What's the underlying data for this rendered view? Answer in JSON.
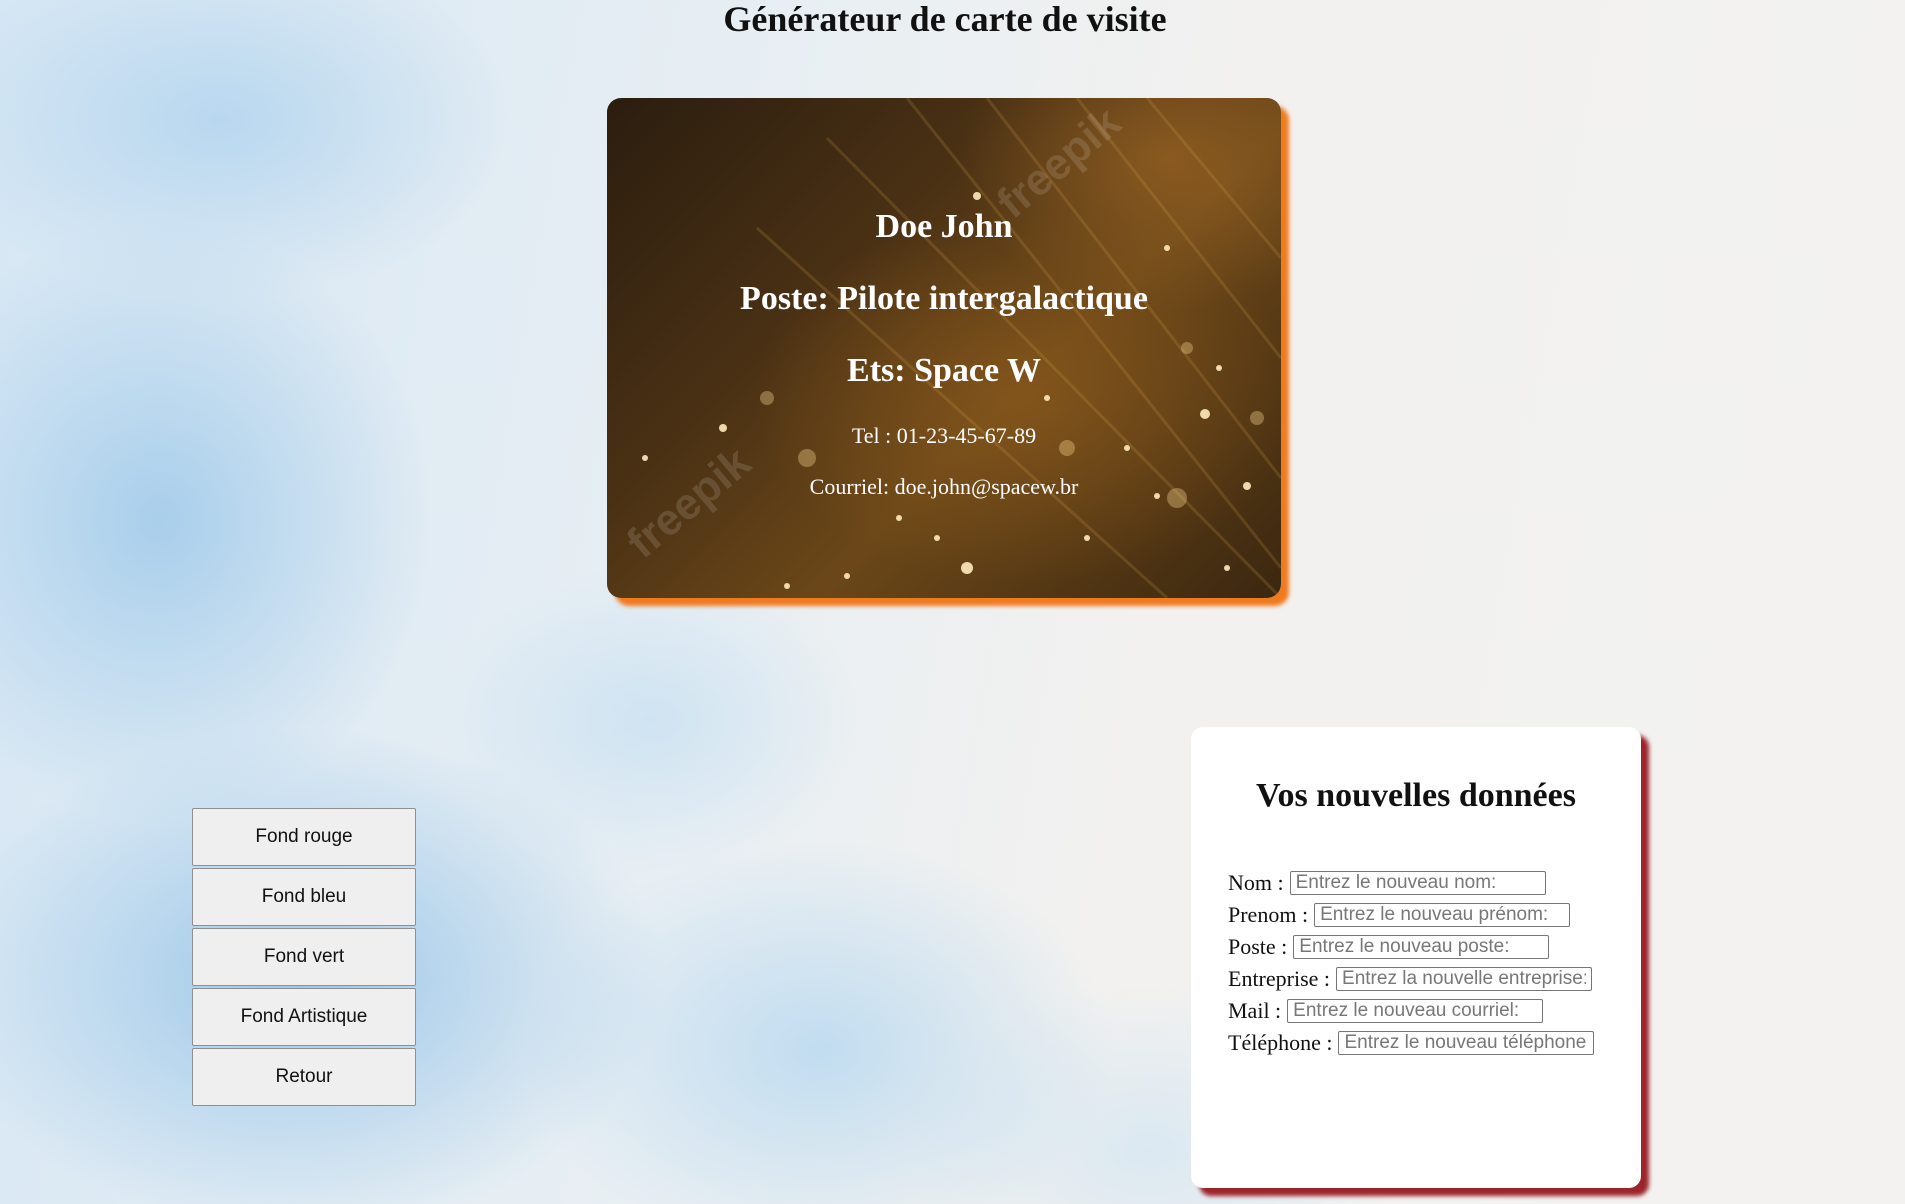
{
  "page": {
    "title": "Générateur de carte de visite"
  },
  "card": {
    "name": "Doe John",
    "poste": "Poste: Pilote intergalactique",
    "ets": "Ets: Space W",
    "tel": "Tel : 01-23-45-67-89",
    "mail": "Courriel: doe.john@spacew.br",
    "watermark": "freepik",
    "accent_color": "#f07a1e"
  },
  "buttons": {
    "red": "Fond rouge",
    "blue": "Fond bleu",
    "green": "Fond vert",
    "artistic": "Fond Artistique",
    "back": "Retour"
  },
  "form": {
    "title": "Vos nouvelles données",
    "accent_color": "#9b252b",
    "nom": {
      "label": "Nom :",
      "placeholder": "Entrez le nouveau nom:",
      "value": ""
    },
    "prenom": {
      "label": "Prenom :",
      "placeholder": "Entrez le nouveau prénom:",
      "value": ""
    },
    "poste": {
      "label": "Poste :",
      "placeholder": "Entrez le nouveau poste:",
      "value": ""
    },
    "entreprise": {
      "label": "Entreprise :",
      "placeholder": "Entrez la nouvelle entreprise:",
      "value": ""
    },
    "mail": {
      "label": "Mail :",
      "placeholder": "Entrez le nouveau courriel:",
      "value": ""
    },
    "telephone": {
      "label": "Téléphone :",
      "placeholder": "Entrez le nouveau téléphone:",
      "value": ""
    }
  }
}
